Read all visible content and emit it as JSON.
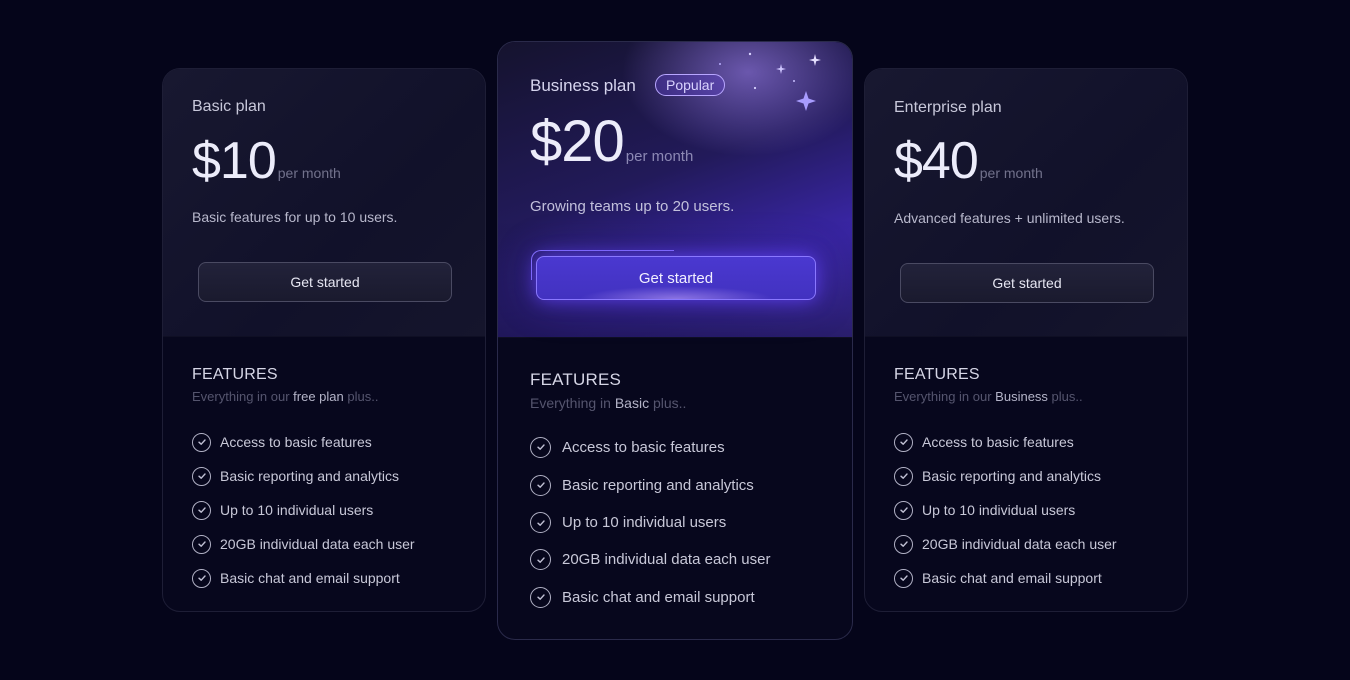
{
  "colors": {
    "background": "#05051a",
    "accent": "#4a38d0",
    "accent_border": "#8a78ff",
    "badge_border": "#b8a6ff"
  },
  "plans": [
    {
      "name": "Basic plan",
      "price": "$10",
      "period": "per month",
      "description": "Basic features for up to 10 users.",
      "cta": "Get started",
      "features_title": "FEATURES",
      "features_sub_prefix": "Everything in our ",
      "features_sub_highlight": "free plan",
      "features_sub_suffix": " plus..",
      "features": [
        "Access to basic features",
        "Basic reporting and analytics",
        "Up to 10 individual users",
        "20GB individual data each user",
        "Basic chat and email support"
      ]
    },
    {
      "name": "Business plan",
      "badge": "Popular",
      "price": "$20",
      "period": "per month",
      "description": "Growing teams up to 20 users.",
      "cta": "Get started",
      "features_title": "FEATURES",
      "features_sub_prefix": "Everything in ",
      "features_sub_highlight": "Basic",
      "features_sub_suffix": " plus..",
      "features": [
        "Access to basic features",
        "Basic reporting and analytics",
        "Up to 10 individual users",
        "20GB individual data each user",
        "Basic chat and email support"
      ]
    },
    {
      "name": "Enterprise plan",
      "price": "$40",
      "period": "per month",
      "description": "Advanced features + unlimited users.",
      "cta": "Get started",
      "features_title": "FEATURES",
      "features_sub_prefix": "Everything in our ",
      "features_sub_highlight": "Business",
      "features_sub_suffix": " plus..",
      "features": [
        "Access to basic features",
        "Basic reporting and analytics",
        "Up to 10 individual users",
        "20GB individual data each user",
        "Basic chat and email support"
      ]
    }
  ]
}
